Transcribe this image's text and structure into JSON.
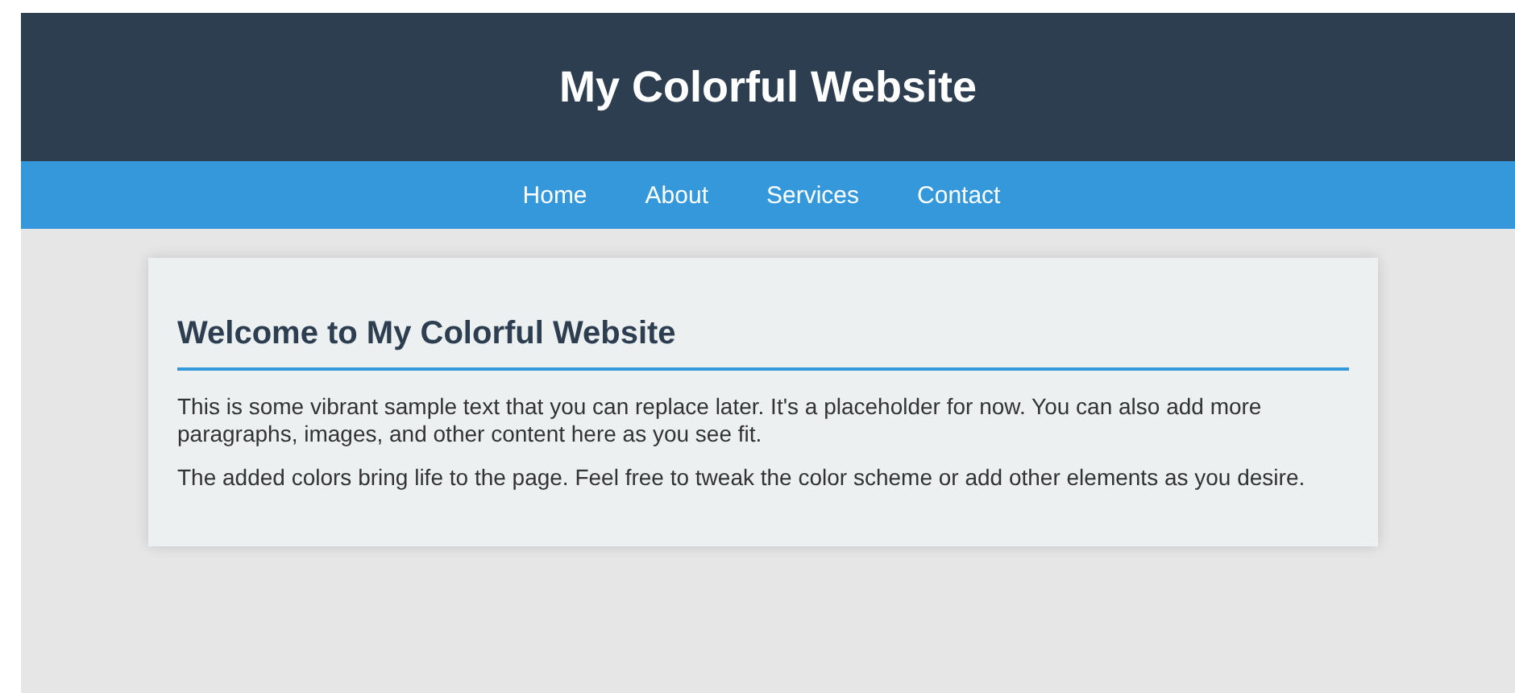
{
  "header": {
    "title": "My Colorful Website"
  },
  "nav": {
    "items": [
      {
        "label": "Home"
      },
      {
        "label": "About"
      },
      {
        "label": "Services"
      },
      {
        "label": "Contact"
      }
    ]
  },
  "content": {
    "heading": "Welcome to My Colorful Website",
    "paragraphs": [
      "This is some vibrant sample text that you can replace later. It's a placeholder for now. You can also add more paragraphs, images, and other content here as you see fit.",
      "The added colors bring life to the page. Feel free to tweak the color scheme or add other elements as you desire."
    ]
  }
}
